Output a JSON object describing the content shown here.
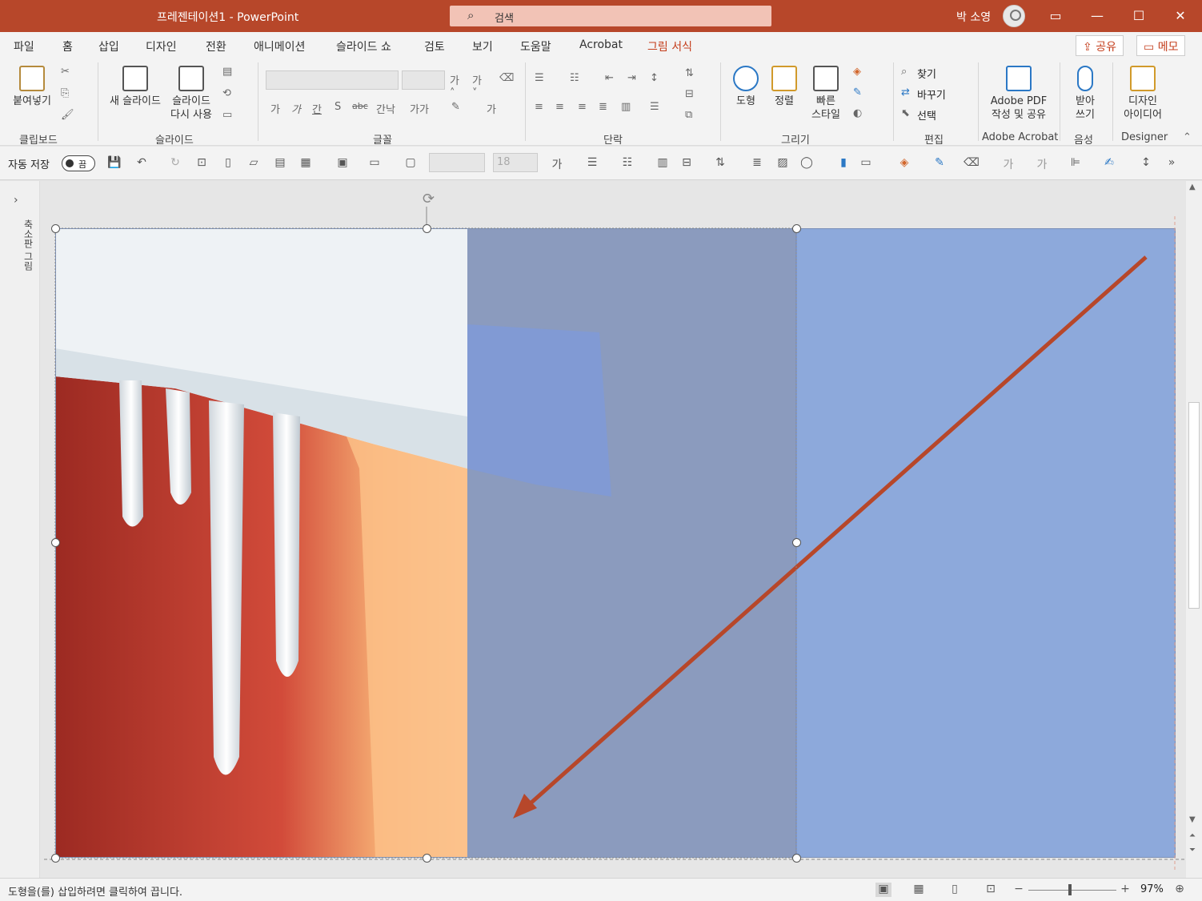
{
  "window": {
    "title": "프레젠테이션1  -  PowerPoint",
    "search_placeholder": "검색",
    "user_name": "박 소영"
  },
  "tabs": [
    "파일",
    "홈",
    "삽입",
    "디자인",
    "전환",
    "애니메이션",
    "슬라이드 쇼",
    "검토",
    "보기",
    "도움말",
    "Acrobat",
    "그림 서식"
  ],
  "share_label": "공유",
  "comment_label": "메모",
  "ribbon": {
    "clipboard": {
      "label": "클립보드",
      "paste": "붙여넣기"
    },
    "slides": {
      "label": "슬라이드",
      "new_slide": "새 슬라이드",
      "reuse_line1": "슬라이드",
      "reuse_line2": "다시 사용"
    },
    "font": {
      "label": "글꼴",
      "font_name": "",
      "font_size": "",
      "grow": "가˄",
      "shrink": "가˅",
      "bold": "가",
      "italic": "가",
      "underline": "간",
      "shadow": "S",
      "strike": "abc",
      "spacing": "간낙",
      "case": "가가",
      "color": "가"
    },
    "paragraph": {
      "label": "단락"
    },
    "drawing": {
      "label": "그리기",
      "shapes": "도형",
      "arrange": "정렬",
      "quick_line1": "빠른",
      "quick_line2": "스타일"
    },
    "editing": {
      "label": "편집",
      "find": "찾기",
      "replace": "바꾸기",
      "select": "선택"
    },
    "acrobat": {
      "label": "Adobe Acrobat",
      "btn_line1": "Adobe PDF",
      "btn_line2": "작성 및 공유"
    },
    "voice": {
      "label": "음성",
      "btn_line1": "받아",
      "btn_line2": "쓰기"
    },
    "designer": {
      "label": "Designer",
      "btn_line1": "디자인",
      "btn_line2": "아이디어"
    }
  },
  "qat": {
    "autosave_label": "자동 저장",
    "autosave_state": "끔",
    "font_size_value": "18"
  },
  "thumbnails_label": "축소판 그림",
  "slide": {
    "colors": {
      "panel_middle": "#8b9bbe",
      "panel_right": "#8da9db",
      "arrow": "#b7472a"
    }
  },
  "status": {
    "message": "도형을(를) 삽입하려면 클릭하여 끕니다.",
    "zoom": "97%",
    "zoom_minus": "−",
    "zoom_plus": "+"
  }
}
